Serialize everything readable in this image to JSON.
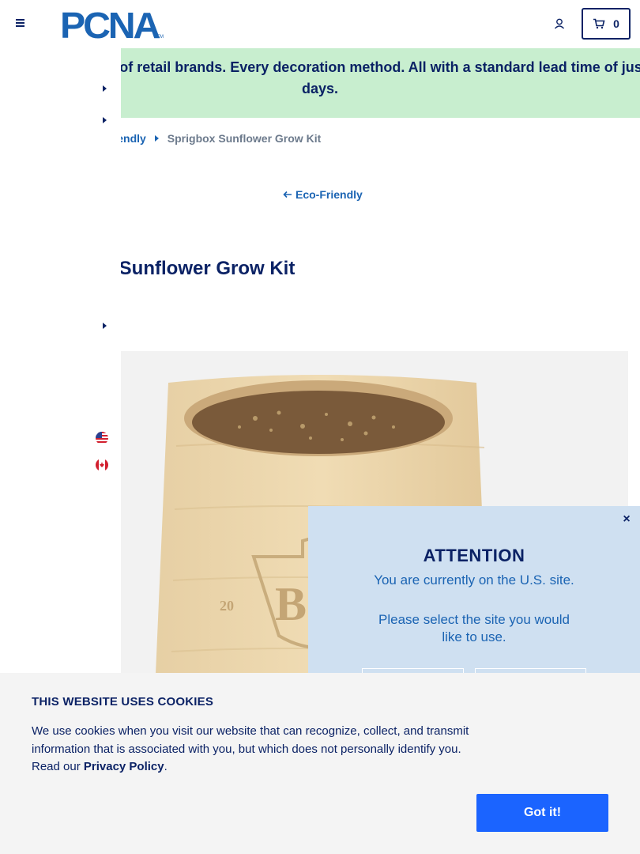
{
  "header": {
    "logo_text": "PCNA",
    "logo_tm": "TM",
    "cart_count": "0"
  },
  "banner": {
    "text": "Thousands of products. Dozens of retail brands. Every decoration method. All with a standard lead time of just five business days."
  },
  "breadcrumb": {
    "parent": "Eco-Friendly",
    "current": "Sprigbox Sunflower Grow Kit"
  },
  "back_link": "Eco-Friendly",
  "product": {
    "title": "Sprigbox Sunflower Grow Kit"
  },
  "attention": {
    "title": "ATTENTION",
    "message": "You are currently on the U.S. site.",
    "prompt": "Please select the site you would like to use.",
    "close": "×"
  },
  "cookie": {
    "title": "THIS WEBSITE USES COOKIES",
    "text": "We use cookies when you visit our website that can recognize, collect, and transmit information that is associated with you, but which does not personally identify you. Read our ",
    "link": "Privacy Policy",
    "after": ".",
    "button": "Got it!"
  },
  "colors": {
    "navy": "#0b2265",
    "blue": "#1b64b3",
    "banner_bg": "#c8eecf",
    "modal_bg": "#cfe0f1",
    "button_blue": "#1b64ff"
  }
}
